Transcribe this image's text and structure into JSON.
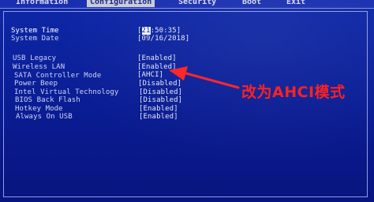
{
  "tabs": [
    {
      "label": "Information",
      "active": false
    },
    {
      "label": "Configuration",
      "active": true
    },
    {
      "label": "Security",
      "active": false
    },
    {
      "label": "Boot",
      "active": false
    },
    {
      "label": "Exit",
      "active": false
    }
  ],
  "datetime": {
    "system_time_label": "System Time",
    "system_time_hour": "21",
    "system_time_rest": ":50:35]",
    "system_time_open": "[",
    "system_date_label": "System Date",
    "system_date_value": "[09/16/2018]"
  },
  "settings": [
    {
      "label": "USB Legacy",
      "value": "[Enabled]"
    },
    {
      "label": "Wireless LAN",
      "value": "[Enabled]"
    },
    {
      "label": "SATA Controller Mode",
      "value": "[AHCI]"
    },
    {
      "label": "Power Beep",
      "value": "[Disabled]"
    },
    {
      "label": "Intel Virtual Technology",
      "value": "[Disabled]"
    },
    {
      "label": "BIOS Back Flash",
      "value": "[Disabled]"
    },
    {
      "label": "Hotkey Mode",
      "value": "[Enabled]"
    },
    {
      "label": "Always On USB",
      "value": "[Enabled]"
    }
  ],
  "annotation": {
    "text": "改为AHCI模式",
    "color": "#ff1a1a"
  },
  "colors": {
    "background": "#0b1f9a",
    "active_tab": "#c9cbd4",
    "text": "#cfd5f3"
  }
}
